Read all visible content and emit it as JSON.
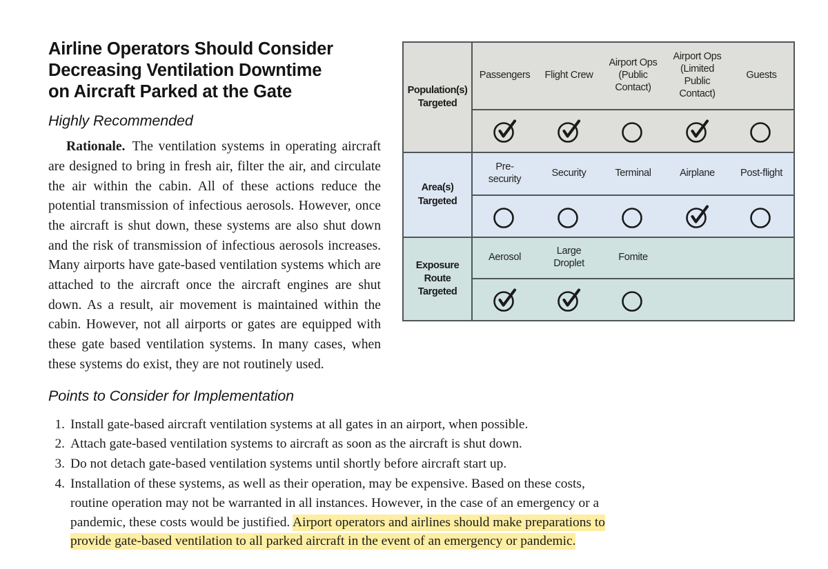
{
  "recommendation": {
    "heading_lines": [
      "Airline Operators Should Consider",
      "Decreasing Ventilation Downtime",
      "on Aircraft Parked at the Gate"
    ],
    "priority_label": "Highly Recommended",
    "rationale_label": "Rationale.",
    "rationale_text": "The ventilation systems in operating aircraft are designed to bring in fresh air, filter the air, and circulate the air within the cabin. All of these actions reduce the potential transmission of infectious aerosols. However, once the aircraft is shut down, these systems are also shut down and the risk of transmission of infectious aerosols increases. Many airports have gate-based ventilation systems which are attached to the aircraft once the aircraft engines are shut down. As a result, air movement is maintained within the cabin. However, not all airports or gates are equipped with these gate based ventilation systems. In many cases, when these systems do exist, they are not routinely used."
  },
  "matrix": {
    "rows": [
      {
        "label": "Population(s)\nTargeted",
        "label_line1": "Population(s)",
        "label_line2": "Targeted",
        "background": "#dededa",
        "columns": [
          {
            "header": "Passengers",
            "marked": true
          },
          {
            "header": "Flight Crew",
            "marked": true
          },
          {
            "header": "Airport Ops (Public Contact)",
            "header_lines": [
              "Airport Ops",
              "(Public",
              "Contact)"
            ],
            "marked": false
          },
          {
            "header": "Airport Ops (Limited Public Contact)",
            "header_lines": [
              "Airport Ops",
              "(Limited",
              "Public",
              "Contact)"
            ],
            "marked": true
          },
          {
            "header": "Guests",
            "marked": false
          }
        ]
      },
      {
        "label": "Area(s)\nTargeted",
        "label_line1": "Area(s)",
        "label_line2": "Targeted",
        "background": "#dde7f3",
        "columns": [
          {
            "header": "Pre-security",
            "header_lines": [
              "Pre-",
              "security"
            ],
            "marked": false
          },
          {
            "header": "Security",
            "marked": false
          },
          {
            "header": "Terminal",
            "marked": false
          },
          {
            "header": "Airplane",
            "marked": true
          },
          {
            "header": "Post-flight",
            "marked": false
          }
        ]
      },
      {
        "label": "Exposure\nRoute\nTargeted",
        "label_line1": "Exposure",
        "label_line2": "Route",
        "label_line3": "Targeted",
        "background": "#cfe2df",
        "columns": [
          {
            "header": "Aerosol",
            "marked": true
          },
          {
            "header": "Large Droplet",
            "header_lines": [
              "Large",
              "Droplet"
            ],
            "marked": true
          },
          {
            "header": "Fomite",
            "marked": false
          },
          {
            "header": "",
            "marked": null
          },
          {
            "header": "",
            "marked": null
          }
        ]
      }
    ],
    "mark_icon_checked": "check-in-circle-icon",
    "mark_icon_unchecked": "empty-circle-icon"
  },
  "points": {
    "heading": "Points to Consider for Implementation",
    "items": [
      {
        "num": "1.",
        "text": "Install gate-based aircraft ventilation systems at all gates in an airport, when possible."
      },
      {
        "num": "2.",
        "text": "Attach gate-based ventilation systems to aircraft as soon as the aircraft is shut down."
      },
      {
        "num": "3.",
        "text": "Do not detach gate-based ventilation systems until shortly before aircraft start up."
      }
    ],
    "item4": {
      "num": "4.",
      "plain_text": "Installation of these systems, as well as their operation, may be expensive. Based on these costs, routine operation may not be warranted in all instances. However, in the case of an emergency or a pandemic, these costs would be justified.",
      "highlighted_text": "Airport operators and airlines should make preparations to provide gate-based ventilation to all parked aircraft in the event of an emergency or pandemic.",
      "highlight_color": "#fdeea2"
    }
  }
}
